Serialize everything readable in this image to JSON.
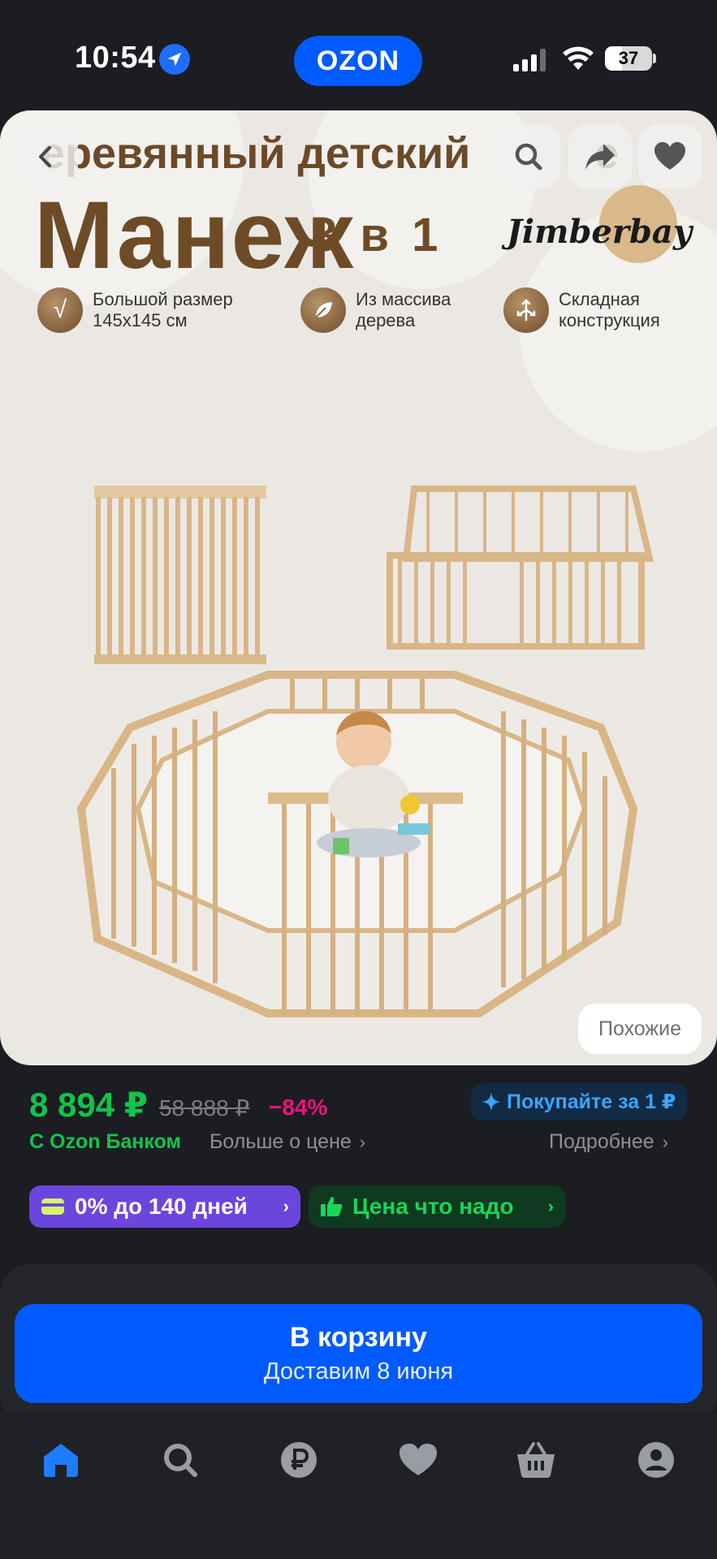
{
  "status_bar": {
    "time": "10:54",
    "app_logo": "OZON",
    "battery": "37",
    "battery_level": 0.37,
    "icons": [
      "location-arrow-icon",
      "signal-icon",
      "wifi-icon",
      "battery-icon"
    ]
  },
  "product_image": {
    "title_line_1": "еревянный детский",
    "title_line_1_tail": "е",
    "title_line_2": "Манеж",
    "title_line_3": "3 в 1",
    "brand": "Jimberbay",
    "features": [
      {
        "icon": "check-icon",
        "text": "Большой размер\n145x145 см"
      },
      {
        "icon": "leaf-icon",
        "text": "Из массива\nдерева"
      },
      {
        "icon": "fold-arrows-icon",
        "text": "Складная\nконструкция"
      }
    ],
    "similar_button": "Похожие"
  },
  "top_buttons": {
    "icons": [
      "back-icon",
      "search-icon",
      "share-icon",
      "favorite-icon"
    ]
  },
  "price": {
    "current": "8 894 ₽",
    "old": "58 888 ₽",
    "discount": "−84%",
    "buy_for_1": "Покупайте за 1 ₽",
    "bank_label": "С Ozon Банком",
    "more_about_price": "Больше о цене",
    "details": "Подробнее"
  },
  "badges": {
    "installment": "0% до 140 дней",
    "good_price": "Цена что надо"
  },
  "cart": {
    "title": "В корзину",
    "delivery": "Доставим 8 июня"
  },
  "tab_bar": {
    "tabs": [
      "home-icon",
      "search-icon",
      "ruble-icon",
      "heart-icon",
      "basket-icon",
      "profile-icon"
    ],
    "active": "home-icon"
  },
  "colors": {
    "background": "#1b1d22",
    "ozon_blue": "#005bff",
    "price_green": "#10c44c",
    "discount_pink": "#f1117e",
    "installment_purple": "#6b46dd",
    "good_price_green": "#18d45a",
    "active_tab": "#1f7bff",
    "inactive_tab": "#9a9ca3"
  }
}
